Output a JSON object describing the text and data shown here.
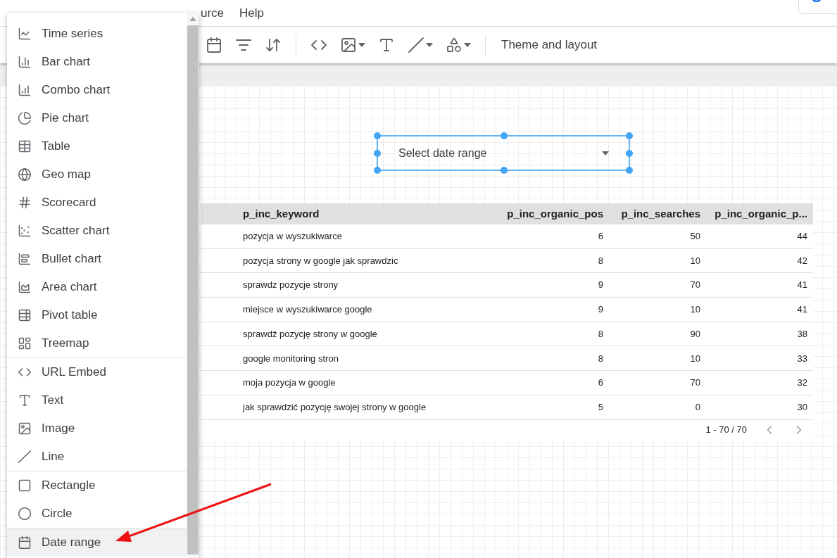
{
  "menubar": {
    "items": [
      "urce",
      "Help"
    ]
  },
  "toolbar": {
    "items": [
      {
        "kind": "calendar"
      },
      {
        "kind": "filter"
      },
      {
        "kind": "sort"
      },
      {
        "kind": "divider"
      },
      {
        "kind": "code"
      },
      {
        "kind": "image",
        "caret": true
      },
      {
        "kind": "text"
      },
      {
        "kind": "line",
        "caret": true
      },
      {
        "kind": "shapes",
        "caret": true
      },
      {
        "kind": "divider"
      }
    ],
    "theme_button": "Theme and layout"
  },
  "insert_menu": {
    "sections": [
      [
        {
          "label": "Time series",
          "kind": "timeseries",
          "selected": false
        },
        {
          "label": "Bar chart",
          "kind": "bar",
          "selected": false
        },
        {
          "label": "Combo chart",
          "kind": "combo",
          "selected": false
        },
        {
          "label": "Pie chart",
          "kind": "pie",
          "selected": false
        },
        {
          "label": "Table",
          "kind": "table",
          "selected": false
        },
        {
          "label": "Geo map",
          "kind": "geo",
          "selected": false
        },
        {
          "label": "Scorecard",
          "kind": "scorecard",
          "selected": false
        },
        {
          "label": "Scatter chart",
          "kind": "scatter",
          "selected": false
        },
        {
          "label": "Bullet chart",
          "kind": "bullet",
          "selected": false
        },
        {
          "label": "Area chart",
          "kind": "area",
          "selected": false
        },
        {
          "label": "Pivot table",
          "kind": "pivot",
          "selected": false
        },
        {
          "label": "Treemap",
          "kind": "treemap",
          "selected": false
        }
      ],
      [
        {
          "label": "URL Embed",
          "kind": "code",
          "selected": false
        },
        {
          "label": "Text",
          "kind": "text",
          "selected": false
        },
        {
          "label": "Image",
          "kind": "image",
          "selected": false
        },
        {
          "label": "Line",
          "kind": "line",
          "selected": false
        }
      ],
      [
        {
          "label": "Rectangle",
          "kind": "rectangle",
          "selected": false
        },
        {
          "label": "Circle",
          "kind": "circle",
          "selected": false
        }
      ],
      [
        {
          "label": "Date range",
          "kind": "calendar",
          "selected": true
        }
      ]
    ]
  },
  "date_control": {
    "placeholder": "Select date range",
    "selected": true
  },
  "table": {
    "columns": [
      "p_inc_keyword",
      "p_inc_organic_pos",
      "p_inc_searches",
      "p_inc_organic_p..."
    ],
    "rows": [
      [
        "pozycja w wyszukiwarce",
        "6",
        "50",
        "44"
      ],
      [
        "pozycja strony w google jak sprawdzic",
        "8",
        "10",
        "42"
      ],
      [
        "sprawdz pozycje strony",
        "9",
        "70",
        "41"
      ],
      [
        "miejsce w wyszukiwarce google",
        "9",
        "10",
        "41"
      ],
      [
        "sprawdź pozycję strony w google",
        "8",
        "90",
        "38"
      ],
      [
        "google monitoring stron",
        "8",
        "10",
        "33"
      ],
      [
        "moja pozycja w google",
        "6",
        "70",
        "32"
      ],
      [
        "jak sprawdzić pozycję swojej strony w google",
        "5",
        "0",
        "30"
      ]
    ],
    "pagination": "1 - 70 / 70"
  }
}
